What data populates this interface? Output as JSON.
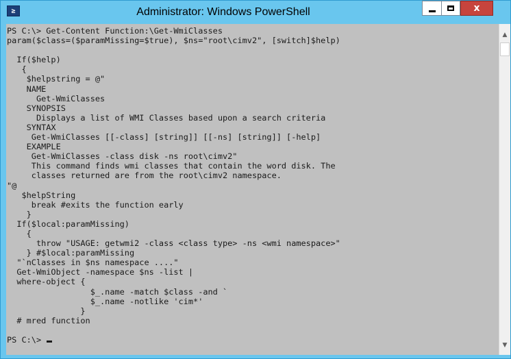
{
  "window": {
    "title": "Administrator: Windows PowerShell",
    "icon": "powershell-icon",
    "icon_glyph": "≥",
    "controls": {
      "minimize": "minimize-icon",
      "maximize": "maximize-icon",
      "close": "close-icon",
      "close_glyph": "x"
    }
  },
  "console": {
    "lines": [
      "PS C:\\> Get-Content Function:\\Get-WmiClasses",
      "param($class=($paramMissing=$true), $ns=\"root\\cimv2\", [switch]$help)",
      "",
      "  If($help)",
      "   {",
      "    $helpstring = @\"",
      "    NAME",
      "      Get-WmiClasses",
      "    SYNOPSIS",
      "      Displays a list of WMI Classes based upon a search criteria",
      "    SYNTAX",
      "     Get-WmiClasses [[-class] [string]] [[-ns] [string]] [-help]",
      "    EXAMPLE",
      "     Get-WmiClasses -class disk -ns root\\cimv2\"",
      "     This command finds wmi classes that contain the word disk. The",
      "     classes returned are from the root\\cimv2 namespace.",
      "\"@",
      "   $helpString",
      "     break #exits the function early",
      "    }",
      "  If($local:paramMissing)",
      "    {",
      "      throw \"USAGE: getwmi2 -class <class type> -ns <wmi namespace>\"",
      "    } #$local:paramMissing",
      "  \"`nClasses in $ns namespace ....\"",
      "  Get-WmiObject -namespace $ns -list |",
      "  where-object {",
      "                 $_.name -match $class -and `",
      "                 $_.name -notlike 'cim*'",
      "               }",
      "  # mred function",
      ""
    ],
    "prompt": "PS C:\\> "
  },
  "scrollbar": {
    "up_icon": "▲",
    "down_icon": "▼"
  }
}
